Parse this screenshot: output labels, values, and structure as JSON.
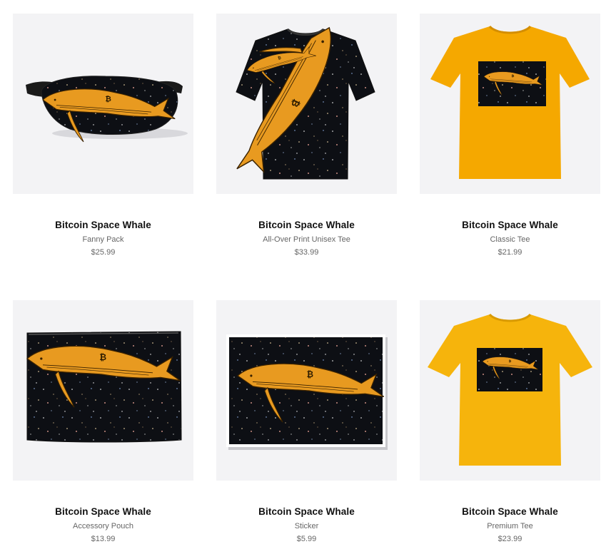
{
  "products": [
    {
      "title": "Bitcoin Space Whale",
      "type": "Fanny Pack",
      "price": "$25.99",
      "image_icon": "fanny-pack-image"
    },
    {
      "title": "Bitcoin Space Whale",
      "type": "All-Over Print Unisex Tee",
      "price": "$33.99",
      "image_icon": "all-over-tee-image"
    },
    {
      "title": "Bitcoin Space Whale",
      "type": "Classic Tee",
      "price": "$21.99",
      "image_icon": "classic-tee-image"
    },
    {
      "title": "Bitcoin Space Whale",
      "type": "Accessory Pouch",
      "price": "$13.99",
      "image_icon": "accessory-pouch-image"
    },
    {
      "title": "Bitcoin Space Whale",
      "type": "Sticker",
      "price": "$5.99",
      "image_icon": "sticker-image"
    },
    {
      "title": "Bitcoin Space Whale",
      "type": "Premium Tee",
      "price": "$23.99",
      "image_icon": "premium-tee-image"
    }
  ],
  "colors": {
    "tile_bg": "#f3f3f5",
    "space": "#0d0f14",
    "whale": "#e89a20",
    "shirt_orange": "#f5a800",
    "shirt_gold": "#f6b40c"
  }
}
